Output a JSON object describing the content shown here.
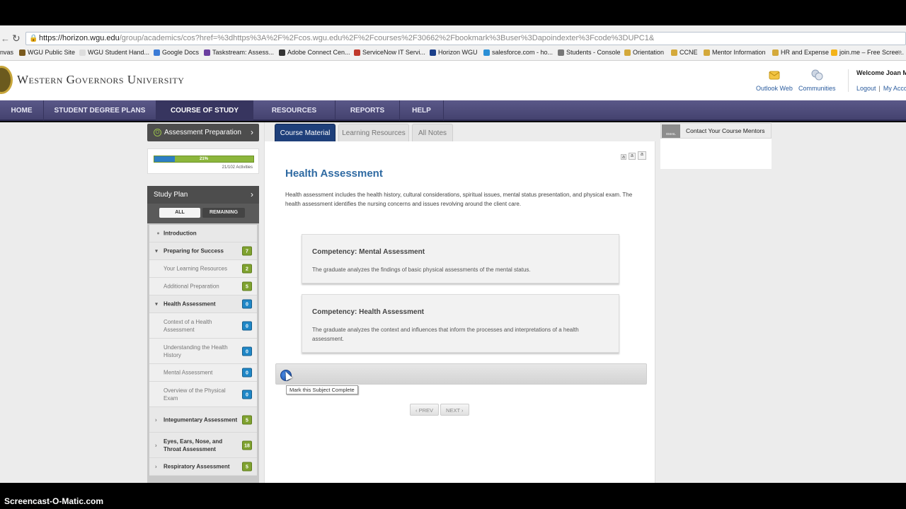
{
  "browser": {
    "url_domain": "https://horizon.wgu.edu",
    "url_path": "/group/academics/cos?href=%3dhttps%3A%2F%2Fcos.wgu.edu%2F%2Fcourses%2F30662%2Fbookmark%3Buser%3Dapoindexter%3Fcode%3DUPC1&",
    "bookmarks": [
      "nvas",
      "WGU Public Site",
      "WGU Student Hand...",
      "Google Docs",
      "Taskstream: Assess...",
      "Adobe Connect Cen...",
      "ServiceNow IT Servi...",
      "Horizon WGU",
      "salesforce.com - ho...",
      "Students - Console",
      "Orientation",
      "CCNE",
      "Mentor Information",
      "HR and Expense",
      "join.me – Free Scree..."
    ]
  },
  "header": {
    "logo_text": "Western Governors University",
    "links": [
      {
        "label": "Outlook Web",
        "icon": "outlook-icon"
      },
      {
        "label": "Communities",
        "icon": "communities-icon"
      }
    ],
    "welcome": "Welcome Joan M",
    "logout": "Logout",
    "my_account": "My Acco"
  },
  "nav": {
    "items": [
      "HOME",
      "STUDENT DEGREE PLANS",
      "COURSE OF STUDY",
      "RESOURCES",
      "REPORTS",
      "HELP"
    ],
    "active": "COURSE OF STUDY"
  },
  "sidebar": {
    "assessment_prep": "Assessment Preparation",
    "progress_pct": "21%",
    "progress_value": 0.21,
    "progress_count": "21/102 Activities",
    "study_plan": "Study Plan",
    "filter_all": "ALL",
    "filter_remaining": "REMAINING",
    "items": [
      {
        "label": "Introduction",
        "badge": "",
        "kind": "dot"
      },
      {
        "label": "Preparing for Success",
        "badge": "7",
        "kind": "top-open",
        "color": "green"
      },
      {
        "label": "Your Learning Resources",
        "badge": "2",
        "kind": "sub",
        "color": "green"
      },
      {
        "label": "Additional Preparation",
        "badge": "5",
        "kind": "sub",
        "color": "green"
      },
      {
        "label": "Health Assessment",
        "badge": "0",
        "kind": "top-open",
        "color": "blue"
      },
      {
        "label": "Context of a Health Assessment",
        "badge": "0",
        "kind": "sub",
        "color": "blue"
      },
      {
        "label": "Understanding the Health History",
        "badge": "0",
        "kind": "sub",
        "color": "blue"
      },
      {
        "label": "Mental Assessment",
        "badge": "0",
        "kind": "sub",
        "color": "blue"
      },
      {
        "label": "Overview of the Physical Exam",
        "badge": "0",
        "kind": "sub",
        "color": "blue"
      },
      {
        "label": "Integumentary Assessment",
        "badge": "5",
        "kind": "top",
        "color": "green"
      },
      {
        "label": "Eyes, Ears, Nose, and Throat Assessment",
        "badge": "18",
        "kind": "top",
        "color": "green"
      },
      {
        "label": "Respiratory Assessment",
        "badge": "5",
        "kind": "top",
        "color": "green"
      }
    ]
  },
  "content": {
    "tabs": [
      "Course Material",
      "Learning Resources",
      "All Notes"
    ],
    "active_tab": "Course Material",
    "font_sizes": [
      "a",
      "a",
      "a"
    ],
    "title": "Health Assessment",
    "description": "Health assessment includes the health history, cultural considerations, spiritual issues, mental status presentation, and physical exam. The health assessment identifies the nursing concerns and issues revolving around the client care.",
    "competencies": [
      {
        "title": "Competency: Mental Assessment",
        "text": "The graduate analyzes the findings of basic physical assessments of the mental status."
      },
      {
        "title": "Competency: Health Assessment",
        "text": "The graduate analyzes the context and influences that inform the processes and interpretations of a health assessment."
      }
    ],
    "tooltip": "Mark this Subject Complete",
    "prev": "PREV",
    "next": "NEXT"
  },
  "right": {
    "mentor_icon_label": "EMAIL",
    "contact_mentors": "Contact Your Course Mentors"
  },
  "watermark": "Screencast-O-Matic.com"
}
